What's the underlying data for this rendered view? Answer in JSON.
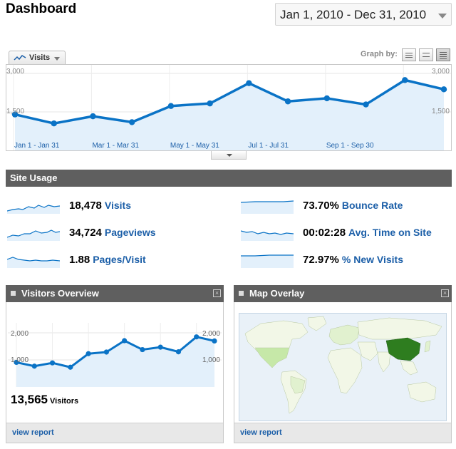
{
  "header": {
    "title": "Dashboard",
    "date_range": "Jan 1, 2010 - Dec 31, 2010"
  },
  "main_chart": {
    "metric_tab_label": "Visits",
    "graph_by_label": "Graph by:",
    "graph_by_options": [
      "day-icon",
      "week-icon",
      "month-icon"
    ],
    "selected_graph_by": "month",
    "y_max_label": "3,000",
    "y_mid_label": "1,500",
    "x_labels": [
      "Jan 1 - Jan 31",
      "Mar 1 - Mar 31",
      "May 1 - May 31",
      "Jul 1 - Jul 31",
      "Sep 1 - Sep 30"
    ],
    "line_color": "#0a73c6",
    "fill_color": "#e3f0fb"
  },
  "chart_data": [
    {
      "type": "area",
      "x": [
        "Jan",
        "Feb",
        "Mar",
        "Apr",
        "May",
        "Jun",
        "Jul",
        "Aug",
        "Sep",
        "Oct",
        "Nov",
        "Dec"
      ],
      "series": [
        {
          "name": "Visits",
          "values": [
            1400,
            1050,
            1330,
            1100,
            1730,
            1830,
            2620,
            1910,
            2030,
            1790,
            2740,
            2380
          ]
        }
      ],
      "ylim": [
        0,
        3000
      ],
      "yticks": [
        "3,000",
        "1,500"
      ]
    },
    {
      "type": "area",
      "x": [
        "Jan",
        "Feb",
        "Mar",
        "Apr",
        "May",
        "Jun",
        "Jul",
        "Aug",
        "Sep",
        "Oct",
        "Nov",
        "Dec"
      ],
      "series": [
        {
          "name": "Visitors",
          "values": [
            910,
            770,
            890,
            730,
            1230,
            1290,
            1710,
            1380,
            1470,
            1300,
            1850,
            1700
          ]
        }
      ],
      "ylim": [
        0,
        2000
      ],
      "yticks": [
        "2,000",
        "1,000"
      ]
    }
  ],
  "site_usage": {
    "title": "Site Usage",
    "metrics": [
      {
        "value": "18,478",
        "label": "Visits"
      },
      {
        "value": "73.70%",
        "label": "Bounce Rate"
      },
      {
        "value": "34,724",
        "label": "Pageviews"
      },
      {
        "value": "00:02:28",
        "label": "Avg. Time on Site"
      },
      {
        "value": "1.88",
        "label": "Pages/Visit"
      },
      {
        "value": "72.97%",
        "label": "% New Visits"
      }
    ]
  },
  "visitors_overview": {
    "title": "Visitors Overview",
    "total": "13,565",
    "total_label": "Visitors",
    "y_max_label": "2,000",
    "y_mid_label": "1,000",
    "link": "view report"
  },
  "map_overlay": {
    "title": "Map Overlay",
    "link": "view report",
    "highlight_color": "#2e7d1f",
    "light_color": "#c6e8a8",
    "land_color": "#f2f7e7"
  }
}
